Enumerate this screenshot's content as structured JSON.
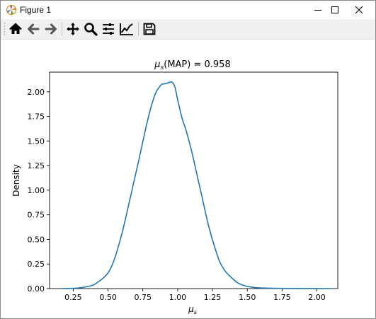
{
  "window": {
    "title": "Figure 1"
  },
  "toolbar": {
    "icons": [
      "home-icon",
      "back-icon",
      "forward-icon",
      "pan-icon",
      "zoom-icon",
      "configure-subplots-icon",
      "edit-axis-icon",
      "save-icon"
    ]
  },
  "chart_data": {
    "type": "line",
    "title": "μs(MAP) = 0.958",
    "title_prefix": "μ",
    "title_sub": "s",
    "title_suffix": "(MAP) = 0.958",
    "xlabel": "μs",
    "xlabel_base": "μ",
    "xlabel_sub": "s",
    "ylabel": "Density",
    "xlim": [
      0.08,
      2.15
    ],
    "ylim": [
      0,
      2.2
    ],
    "x_ticks": [
      0.25,
      0.5,
      0.75,
      1.0,
      1.25,
      1.5,
      1.75,
      2.0
    ],
    "x_tick_labels": [
      "0.25",
      "0.50",
      "0.75",
      "1.00",
      "1.25",
      "1.50",
      "1.75",
      "2.00"
    ],
    "y_ticks": [
      0.0,
      0.25,
      0.5,
      0.75,
      1.0,
      1.25,
      1.5,
      1.75,
      2.0
    ],
    "y_tick_labels": [
      "0.00",
      "0.25",
      "0.50",
      "0.75",
      "1.00",
      "1.25",
      "1.50",
      "1.75",
      "2.00"
    ],
    "grid": false,
    "series": [
      {
        "color": "#1f77b4",
        "x": [
          0.17,
          0.25,
          0.3,
          0.35,
          0.4,
          0.43,
          0.46,
          0.5,
          0.53,
          0.56,
          0.6,
          0.64,
          0.68,
          0.72,
          0.76,
          0.8,
          0.84,
          0.88,
          0.9,
          0.93,
          0.958,
          0.98,
          1.0,
          1.03,
          1.06,
          1.1,
          1.14,
          1.18,
          1.22,
          1.26,
          1.3,
          1.34,
          1.38,
          1.43,
          1.48,
          1.53,
          1.58,
          1.65,
          1.75,
          1.85,
          2.0,
          2.1
        ],
        "y": [
          0.0,
          0.003,
          0.008,
          0.02,
          0.04,
          0.07,
          0.1,
          0.16,
          0.24,
          0.36,
          0.56,
          0.8,
          1.05,
          1.3,
          1.56,
          1.8,
          1.98,
          2.07,
          2.08,
          2.09,
          2.1,
          2.05,
          1.92,
          1.74,
          1.61,
          1.4,
          1.15,
          0.9,
          0.65,
          0.45,
          0.28,
          0.18,
          0.12,
          0.06,
          0.03,
          0.015,
          0.008,
          0.004,
          0.002,
          0.001,
          0.0005,
          0.0
        ]
      }
    ]
  }
}
